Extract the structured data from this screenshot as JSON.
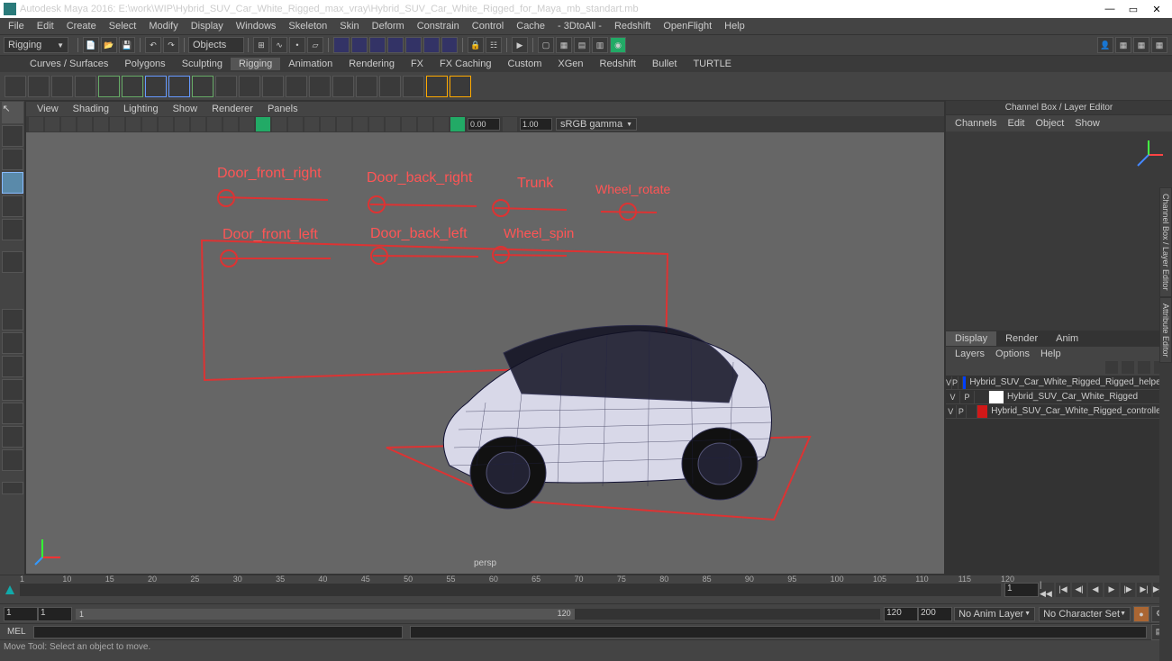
{
  "window": {
    "title": "Autodesk Maya 2016: E:\\work\\WIP\\Hybrid_SUV_Car_White_Rigged_max_vray\\Hybrid_SUV_Car_White_Rigged_for_Maya_mb_standart.mb"
  },
  "menubar": [
    "File",
    "Edit",
    "Create",
    "Select",
    "Modify",
    "Display",
    "Windows",
    "Skeleton",
    "Skin",
    "Deform",
    "Constrain",
    "Control",
    "Cache",
    "- 3DtoAll -",
    "Redshift",
    "OpenFlight",
    "Help"
  ],
  "module": "Rigging",
  "obj_mode": "Objects",
  "shelf_tabs": [
    "Curves / Surfaces",
    "Polygons",
    "Sculpting",
    "Rigging",
    "Animation",
    "Rendering",
    "FX",
    "FX Caching",
    "Custom",
    "XGen",
    "Redshift",
    "Bullet",
    "TURTLE"
  ],
  "shelf_active": "Rigging",
  "viewport_menu": [
    "View",
    "Shading",
    "Lighting",
    "Show",
    "Renderer",
    "Panels"
  ],
  "vp_num1": "0.00",
  "vp_num2": "1.00",
  "vp_colorspace": "sRGB gamma",
  "persp": "persp",
  "channelbox_title": "Channel Box / Layer Editor",
  "ch_menu": [
    "Channels",
    "Edit",
    "Object",
    "Show"
  ],
  "layer_tabs": [
    "Display",
    "Render",
    "Anim"
  ],
  "layer_tab_active": "Display",
  "layer_menu": [
    "Layers",
    "Options",
    "Help"
  ],
  "layers": [
    {
      "v": "V",
      "p": "P",
      "color": "#0040ff",
      "name": "Hybrid_SUV_Car_White_Rigged_Rigged_helpers"
    },
    {
      "v": "V",
      "p": "P",
      "color": "#ffffff",
      "name": "Hybrid_SUV_Car_White_Rigged"
    },
    {
      "v": "V",
      "p": "P",
      "color": "#d01818",
      "name": "Hybrid_SUV_Car_White_Rigged_controllers"
    }
  ],
  "right_tabs": [
    "Channel Box / Layer Editor",
    "Attribute Editor"
  ],
  "timeline": {
    "ticks": [
      "1",
      "10",
      "15",
      "20",
      "25",
      "30",
      "35",
      "40",
      "45",
      "50",
      "55",
      "60",
      "65",
      "70",
      "75",
      "80",
      "85",
      "90",
      "95",
      "100",
      "105",
      "110",
      "115",
      "120"
    ],
    "current": "1",
    "range_start": "1",
    "range_startB": "1",
    "range_end": "120",
    "range_endB": "200",
    "anim_layer": "No Anim Layer",
    "char_set": "No Character Set"
  },
  "cmd_label": "MEL",
  "helpline": "Move Tool: Select an object to move.",
  "rig_controls": {
    "r1": [
      "Door_front_right",
      "Door_back_right",
      "Trunk",
      "Wheel_rotate"
    ],
    "r2": [
      "Door_front_left",
      "Door_back_left",
      "Wheel_spin"
    ]
  }
}
